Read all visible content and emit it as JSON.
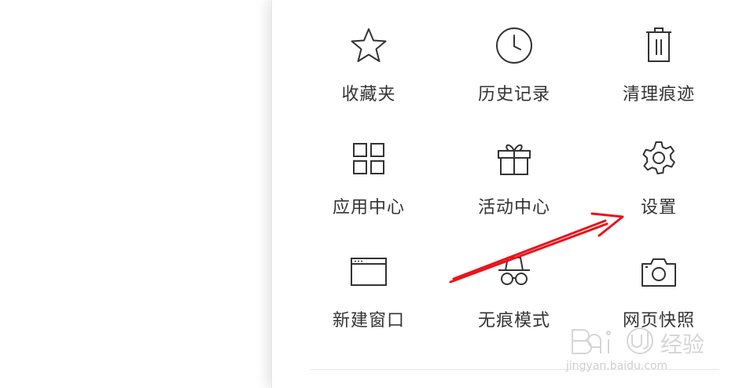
{
  "menu": {
    "items": [
      {
        "label": "收藏夹",
        "icon": "star-icon"
      },
      {
        "label": "历史记录",
        "icon": "clock-icon"
      },
      {
        "label": "清理痕迹",
        "icon": "trash-icon"
      },
      {
        "label": "应用中心",
        "icon": "grid-icon"
      },
      {
        "label": "活动中心",
        "icon": "gift-icon"
      },
      {
        "label": "设置",
        "icon": "gear-icon"
      },
      {
        "label": "新建窗口",
        "icon": "window-icon"
      },
      {
        "label": "无痕模式",
        "icon": "incognito-icon"
      },
      {
        "label": "网页快照",
        "icon": "camera-icon"
      }
    ]
  },
  "colors": {
    "icon_stroke": "#333333",
    "label_text": "#333333",
    "annotation_arrow": "#e8141c"
  },
  "watermark": {
    "brand": "Bai du 经验",
    "url": "jingyan.baidu.com"
  }
}
